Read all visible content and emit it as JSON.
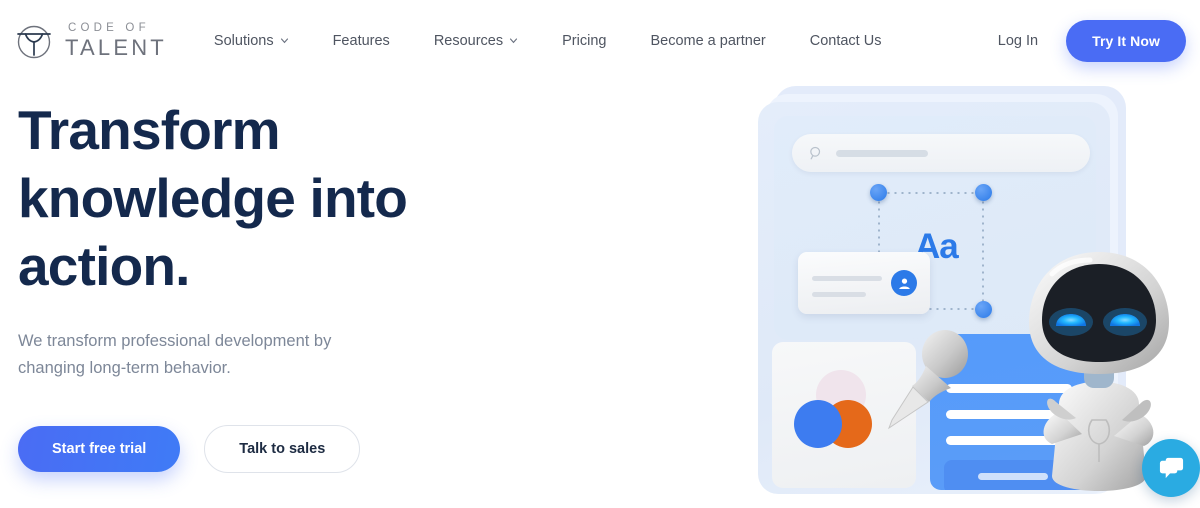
{
  "brand": {
    "logo_icon": "code-of-talent-emblem-icon",
    "name_top": "CODE OF",
    "name_bottom": "TALENT"
  },
  "header": {
    "nav": [
      {
        "label": "Solutions",
        "has_dropdown": true,
        "icon": "chevron-down-icon"
      },
      {
        "label": "Features",
        "has_dropdown": false
      },
      {
        "label": "Resources",
        "has_dropdown": true,
        "icon": "chevron-down-icon"
      },
      {
        "label": "Pricing",
        "has_dropdown": false
      },
      {
        "label": "Become a partner",
        "has_dropdown": false
      },
      {
        "label": "Contact Us",
        "has_dropdown": false
      }
    ],
    "login_label": "Log In",
    "cta_label": "Try It Now"
  },
  "hero": {
    "title": "Transform knowledge into action.",
    "subtitle": "We transform professional development by changing long-term behavior.",
    "primary_cta": "Start free trial",
    "secondary_cta": "Talk to sales"
  },
  "illustration": {
    "alt": "3D robot assistant beside layered app panels",
    "search_icon": "search-icon",
    "text_tool_label": "Aa",
    "avatar_icon": "user-avatar-icon",
    "pin_icon": "pushpin-tool-icon",
    "robot_icon": "robot-mascot-icon",
    "selection_handles": 3
  },
  "chat_widget": {
    "icon": "chat-bubbles-icon",
    "label": "Open chat"
  },
  "colors": {
    "accent_blue": "#4a6cf4",
    "heading_navy": "#14294d",
    "body_gray": "#7d8798",
    "nav_gray": "#4f5561",
    "panel_blue": "#e1ecfa",
    "card_blue": "#559bfb",
    "orange": "#e5691a",
    "chat_cyan": "#2aabe2"
  }
}
